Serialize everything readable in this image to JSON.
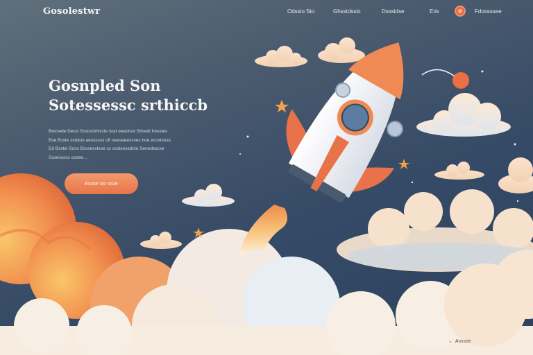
{
  "brand": {
    "logo_text": "Gosolestwr"
  },
  "nav": {
    "links": [
      "Odssio Sto",
      "Ghsstdssio",
      "Dsssidse",
      "Eris"
    ],
    "profile_label": "Fdossssee",
    "cta_icon": "orbit-dot-icon"
  },
  "hero": {
    "title_line1": "Gosnpled Son",
    "title_line2": "Sotessessc srthiccb",
    "body_lines": [
      "Bessede Dessi Ssstsohhiccte issd eeeotsst Sttsedt hesstes",
      "Bse Bsste sctstoo aessssss oft oeeseeesssec boe eccetsoss",
      "Ed Bsstel Soss Bsssesstsse sc ssstsesedoio Senedsscse",
      "Sssesssss cesee..."
    ],
    "cta_label": "Essoe sto ssoe"
  },
  "footer": {
    "note": "Asssoe"
  },
  "colors": {
    "sky_top": "#5f6f7b",
    "sky_bottom": "#2e4260",
    "accent": "#e8754a",
    "cloud": "#f5e6d6"
  }
}
